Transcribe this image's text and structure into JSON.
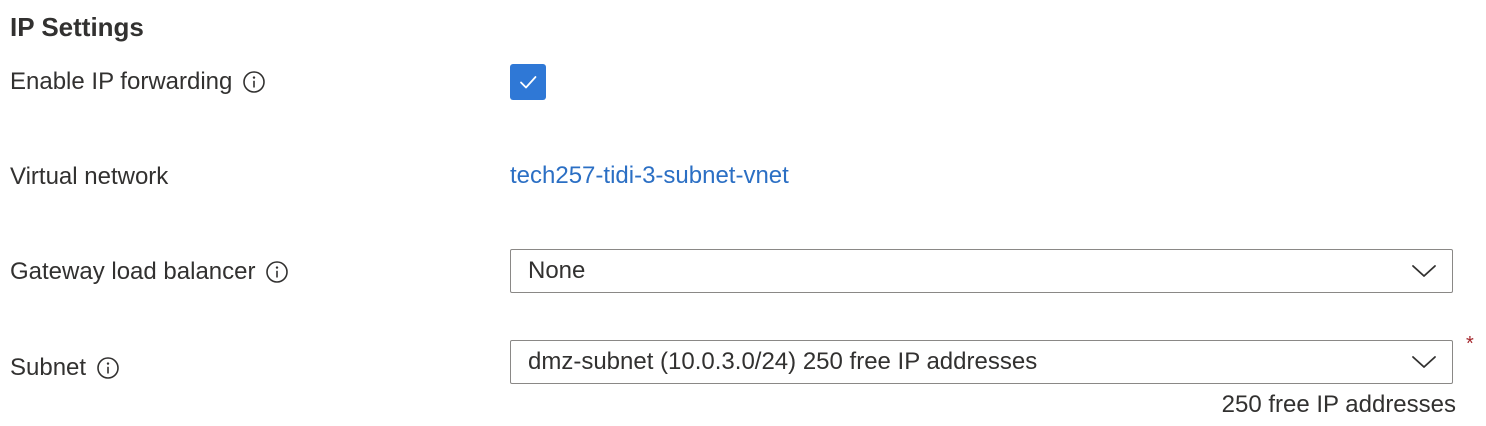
{
  "section": {
    "title": "IP Settings"
  },
  "ip_forwarding": {
    "label": "Enable IP forwarding",
    "checked": true,
    "info_icon": "info-icon"
  },
  "virtual_network": {
    "label": "Virtual network",
    "link_text": "tech257-tidi-3-subnet-vnet"
  },
  "gateway_load_balancer": {
    "label": "Gateway load balancer",
    "selected_value": "None",
    "info_icon": "info-icon"
  },
  "subnet": {
    "label": "Subnet",
    "selected_value": "dmz-subnet (10.0.3.0/24) 250 free IP addresses",
    "required_marker": "*",
    "helper_text": "250 free IP addresses",
    "info_icon": "info-icon"
  },
  "colors": {
    "checkbox_accent": "#2f78d6",
    "link": "#2b6fc4",
    "required": "#a4262c",
    "border": "#8a8886",
    "text": "#323130"
  }
}
